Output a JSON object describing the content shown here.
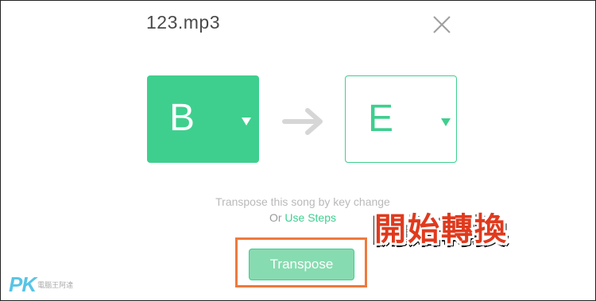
{
  "dialog": {
    "file_name": "123.mp3"
  },
  "keys": {
    "from": "B",
    "to": "E"
  },
  "description": {
    "line1": "Transpose this song by key change",
    "prefix": "Or ",
    "use_steps_link": "Use Steps"
  },
  "actions": {
    "transpose_label": "Transpose"
  },
  "annotation": {
    "badge_text": "開始轉換"
  },
  "watermark": {
    "logo_text": "PK",
    "logo_sub": "電腦王阿達"
  },
  "colors": {
    "accent": "#3ecf8e",
    "button_fill": "#86dbb0",
    "highlight": "#ef7a3c",
    "badge": "#e03a1e"
  },
  "icons": {
    "close": "close-icon",
    "arrow": "arrow-right-icon",
    "caret": "caret-down-icon"
  }
}
